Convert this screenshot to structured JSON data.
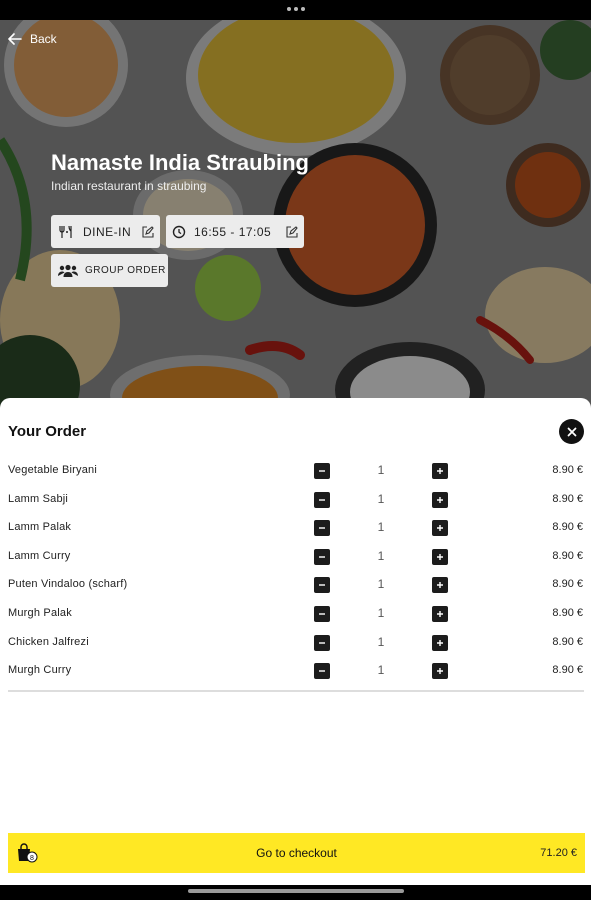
{
  "header": {
    "back_label": "Back"
  },
  "restaurant": {
    "name": "Namaste India Straubing",
    "tagline": "Indian restaurant in straubing"
  },
  "chips": {
    "service_mode": "DINE-IN",
    "time_slot": "16:55 - 17:05",
    "group_order": "GROUP ORDER"
  },
  "order": {
    "title": "Your Order",
    "items": [
      {
        "name": "Vegetable Biryani",
        "qty": "1",
        "price": "8.90 €"
      },
      {
        "name": "Lamm Sabji",
        "qty": "1",
        "price": "8.90 €"
      },
      {
        "name": "Lamm Palak",
        "qty": "1",
        "price": "8.90 €"
      },
      {
        "name": "Lamm Curry",
        "qty": "1",
        "price": "8.90 €"
      },
      {
        "name": "Puten Vindaloo (scharf)",
        "qty": "1",
        "price": "8.90 €"
      },
      {
        "name": "Murgh Palak",
        "qty": "1",
        "price": "8.90 €"
      },
      {
        "name": "Chicken Jalfrezi",
        "qty": "1",
        "price": "8.90 €"
      },
      {
        "name": "Murgh Curry",
        "qty": "1",
        "price": "8.90 €"
      }
    ]
  },
  "checkout": {
    "label": "Go to checkout",
    "total": "71.20 €",
    "bag_count": "8"
  },
  "colors": {
    "accent": "#ffe824",
    "button_dark": "#1c1c1c",
    "chip_bg": "#ececec"
  },
  "icons": [
    "back-arrow-icon",
    "dine-in-icon",
    "edit-icon",
    "clock-icon",
    "group-icon",
    "close-icon",
    "minus-icon",
    "plus-icon",
    "shopping-bag-icon"
  ]
}
